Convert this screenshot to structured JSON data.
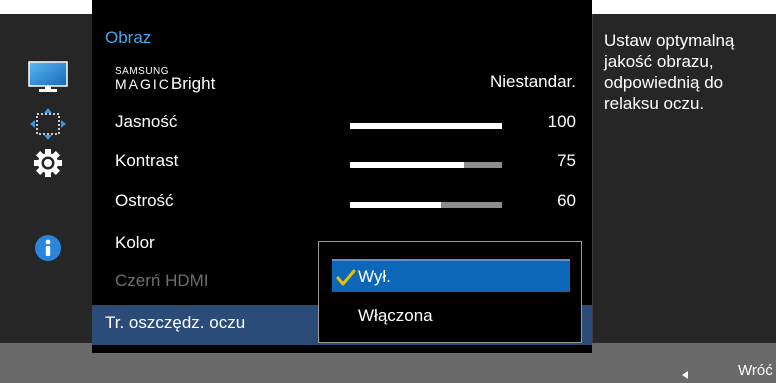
{
  "menu": {
    "title": "Obraz",
    "items": [
      {
        "brand_small": "SAMSUNG",
        "brand_large": "MAGIC",
        "label_suffix": "Bright",
        "value": "Niestandar."
      },
      {
        "label": "Jasność",
        "value": "100",
        "level": 100
      },
      {
        "label": "Kontrast",
        "value": "75",
        "level": 75
      },
      {
        "label": "Ostrość",
        "value": "60",
        "level": 60
      },
      {
        "label": "Kolor"
      },
      {
        "label": "Czerń HDMI",
        "disabled": true
      },
      {
        "label": "Tr. oszczędz. oczu",
        "selected": true
      }
    ]
  },
  "dropdown": {
    "options": [
      {
        "label": "Wył.",
        "checked": true
      },
      {
        "label": "Włączona",
        "checked": false
      }
    ]
  },
  "description": "Ustaw optymalną jakość obrazu, odpowiednią do relaksu oczu.",
  "rail": {
    "icons": [
      "monitor-icon",
      "resize-arrows-icon",
      "gear-icon",
      "info-icon"
    ]
  },
  "footer": {
    "back_label": "Wróć"
  },
  "colors": {
    "accent": "#4aa6ea",
    "selected_row": "#2b4c78",
    "selected_option": "#0d67b8",
    "check": "#e6c300"
  }
}
